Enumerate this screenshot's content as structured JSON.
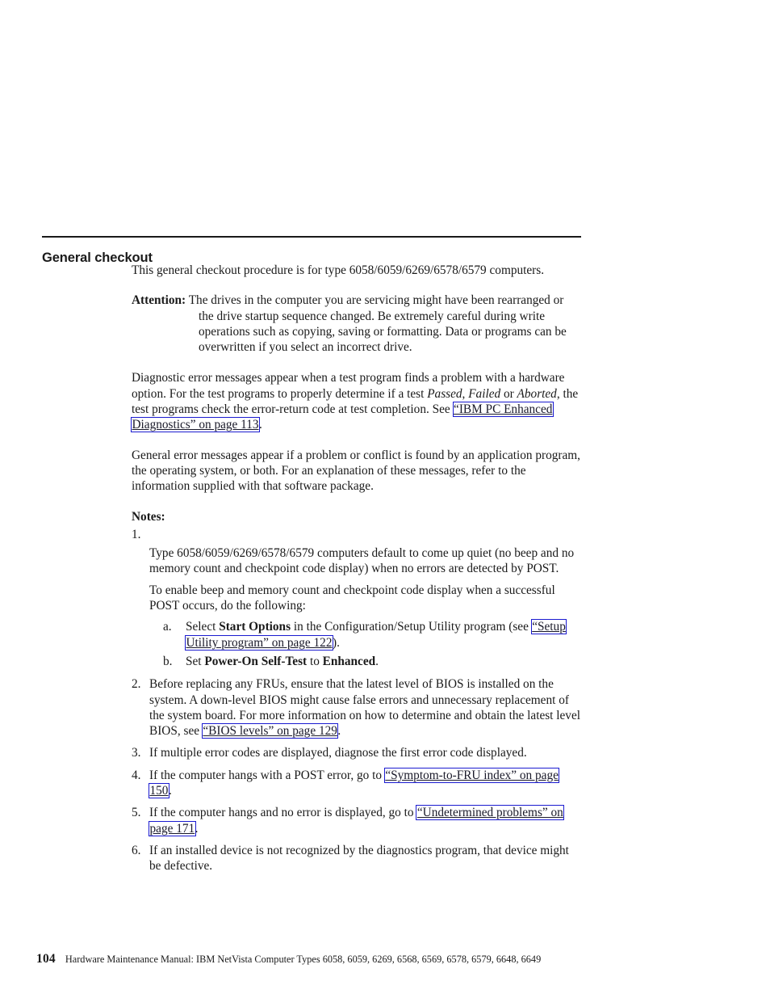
{
  "document": {
    "section_heading": "General checkout",
    "intro": "This general checkout procedure is for type 6058/6059/6269/6578/6579 computers.",
    "attention": {
      "label": "Attention:",
      "text": "The drives in the computer you are servicing might have been rearranged or the drive startup sequence changed. Be extremely careful during write operations such as copying, saving or formatting. Data or programs can be overwritten if you select an incorrect drive."
    },
    "diagnostic_paragraph": {
      "part1": "Diagnostic error messages appear when a test program finds a problem with a hardware option. For the test programs to properly determine if a test ",
      "italic1": "Passed",
      "part2": ", ",
      "italic2": "Failed",
      "part3": " or ",
      "italic3": "Aborted",
      "part4": ", the test programs check the error-return code at test completion. See ",
      "link": "“IBM PC Enhanced Diagnostics” on page 113",
      "part5": "."
    },
    "general_paragraph": "General error messages appear if a problem or conflict is found by an application program, the operating system, or both. For an explanation of these messages, refer to the information supplied with that software package.",
    "notes_label": "Notes:",
    "note1": {
      "marker": "1.",
      "paragraph1": "Type 6058/6059/6269/6578/6579 computers default to come up quiet (no beep and no memory count and checkpoint code display) when no errors are detected by POST.",
      "paragraph2": "To enable beep and memory count and checkpoint code display when a successful POST occurs, do the following:",
      "sub_items": [
        {
          "marker": "a.",
          "part1": "Select ",
          "bold1": "Start Options",
          "part2": " in the Configuration/Setup Utility program (see ",
          "link": "“Setup Utility program” on page 122",
          "part3": ")."
        },
        {
          "marker": "b.",
          "part1": "Set ",
          "bold1": "Power-On Self-Test",
          "part2": " to ",
          "bold2": "Enhanced",
          "part3": "."
        }
      ]
    },
    "notes": [
      {
        "marker": "2.",
        "part1": "Before replacing any FRUs, ensure that the latest level of BIOS is installed on the system. A down-level BIOS might cause false errors and unnecessary replacement of the system board. For more information on how to determine and obtain the latest level BIOS, see ",
        "link": "“BIOS levels” on page 129",
        "part2": "."
      },
      {
        "marker": "3.",
        "part1": "If multiple error codes are displayed, diagnose the first error code displayed.",
        "link": "",
        "part2": ""
      },
      {
        "marker": "4.",
        "part1": "If the computer hangs with a POST error, go to ",
        "link": "“Symptom-to-FRU index” on page 150",
        "part2": "."
      },
      {
        "marker": "5.",
        "part1": "If the computer hangs and no error is displayed, go to ",
        "link": "“Undetermined problems” on page 171",
        "part2": "."
      },
      {
        "marker": "6.",
        "part1": "If an installed device is not recognized by the diagnostics program, that device might be defective.",
        "link": "",
        "part2": ""
      }
    ],
    "footer": {
      "page_number": "104",
      "text": "Hardware Maintenance Manual: IBM NetVista Computer Types 6058, 6059, 6269, 6568, 6569, 6578, 6579, 6648, 6649"
    },
    "colors": {
      "text": "#1a1a1a",
      "link_box": "#1b1bd0",
      "link_text": "#1a1a2a",
      "rule": "#1a1a1a",
      "background": "#ffffff"
    }
  }
}
